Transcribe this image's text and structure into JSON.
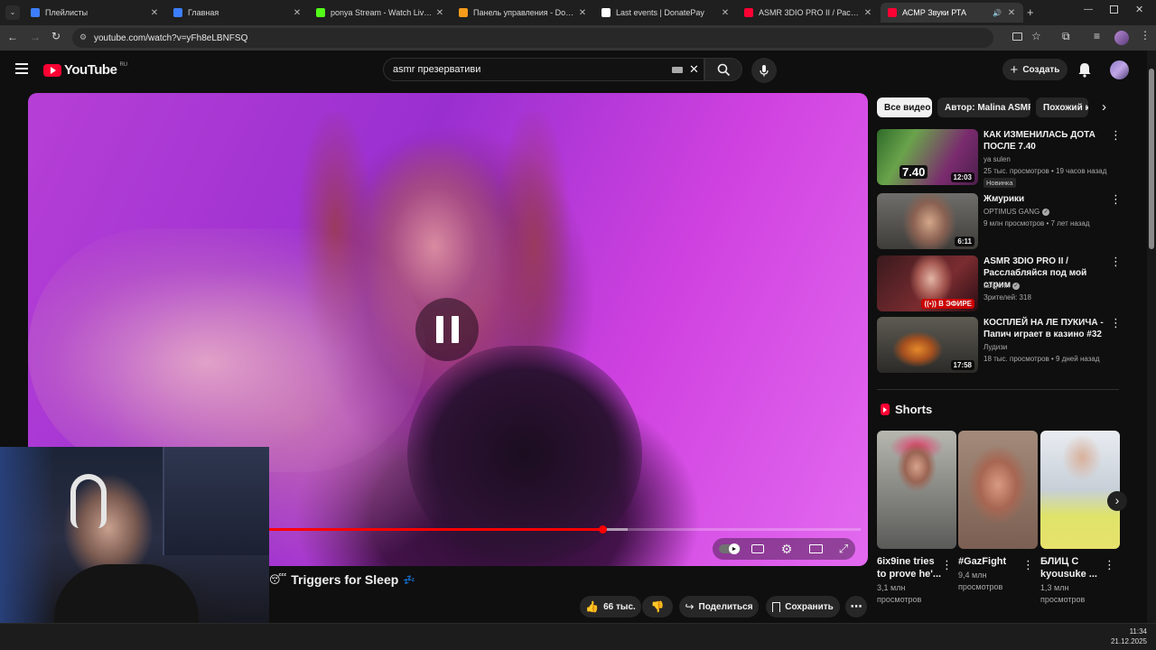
{
  "browser": {
    "tabs": [
      {
        "title": "Плейлисты",
        "color": "#3d7eff"
      },
      {
        "title": "Главная",
        "color": "#3d7eff"
      },
      {
        "title": "ponya Stream - Watch Live on Kick",
        "color": "#53fc18"
      },
      {
        "title": "Панель управления - DonationAlerts",
        "color": "#f59c1a"
      },
      {
        "title": "Last events | DonatePay",
        "color": "#ffffff"
      },
      {
        "title": "ASMR 3DIO PRO II / Расслабляйся",
        "color": "#ff0033"
      },
      {
        "title": "АСМР Звуки РТА",
        "color": "#ff0033"
      }
    ],
    "url": "youtube.com/watch?v=yFh8eLBNFSQ"
  },
  "youtube": {
    "logo_text": "YouTube",
    "region": "RU",
    "search_value": "asmr презервативи",
    "create_label": "Создать"
  },
  "player": {
    "progress": 0.69,
    "buffered": 0.72
  },
  "video": {
    "title": "Triggers for Sleep",
    "likes": "66 тыс.",
    "share_label": "Поделиться",
    "save_label": "Сохранить"
  },
  "chips": [
    "Все видео",
    "Автор: Malina ASMR",
    "Похожий к"
  ],
  "recommendations": [
    {
      "title": "КАК ИЗМЕНИЛАСЬ ДОТА ПОСЛЕ 7.40",
      "channel": "ya sulen",
      "stats": "25 тыс. просмотров • 19 часов назад",
      "badge": "Новинка",
      "duration": "12:03",
      "thumb_text": "7.40"
    },
    {
      "title": "Жмурики",
      "channel": "OPTIMUS GANG",
      "stats": "9 млн просмотров • 7 лет назад",
      "duration": "6:11"
    },
    {
      "title": "ASMR 3DIO PRO II / Расслабляйся под мой стрим",
      "channel": "tangerin",
      "stats": "Зрителей: 318",
      "live": "В ЭФИРЕ"
    },
    {
      "title": "КОСПЛЕЙ НА ЛЕ ПУКИЧА - Папич играет в казино #32",
      "channel": "Лудизи",
      "stats": "18 тыс. просмотров • 9 дней назад",
      "duration": "17:58"
    }
  ],
  "shorts": {
    "heading": "Shorts",
    "items": [
      {
        "title": "6ix9ine tries to prove he'...",
        "views": "3,1 млн просмотров"
      },
      {
        "title": "#GazFight",
        "views": "9,4 млн просмотров"
      },
      {
        "title": "БЛИЦ С kyousuke ...",
        "views": "1,3 млн просмотров"
      }
    ]
  },
  "taskbar": {
    "time": "11:34",
    "date": "21.12.2025"
  }
}
